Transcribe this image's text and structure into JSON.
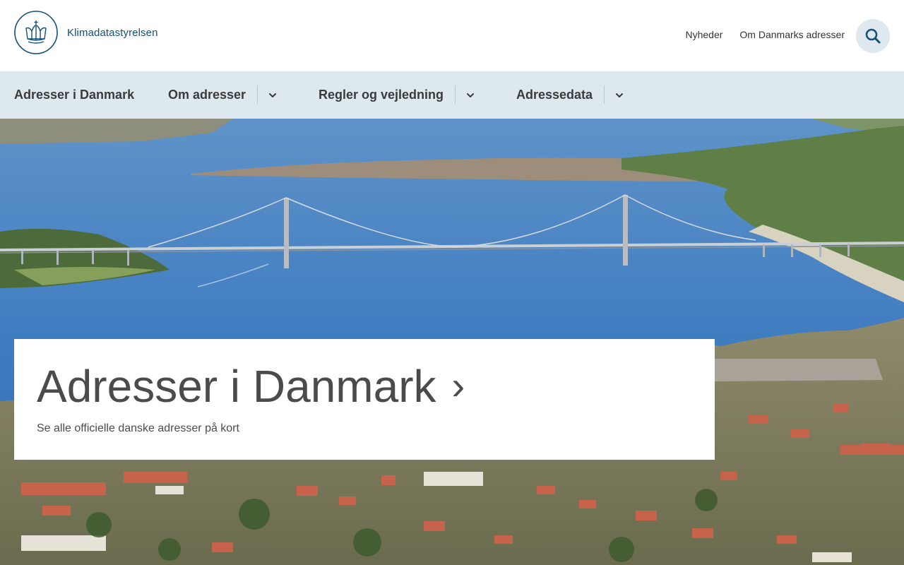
{
  "header": {
    "logo_text": "Klimadatastyrelsen",
    "links": [
      "Nyheder",
      "Om Danmarks adresser"
    ],
    "search_icon": "search-icon"
  },
  "nav": {
    "items": [
      {
        "label": "Adresser i Danmark",
        "has_dropdown": false
      },
      {
        "label": "Om adresser",
        "has_dropdown": true
      },
      {
        "label": "Regler og vejledning",
        "has_dropdown": true
      },
      {
        "label": "Adressedata",
        "has_dropdown": true
      }
    ]
  },
  "hero": {
    "image": "aerial-bridge-photo",
    "card_title": "Adresser i Danmark",
    "card_arrow": "›",
    "card_subtitle": "Se alle officielle danske adresser på kort"
  },
  "colors": {
    "brand": "#14507a",
    "nav_bg": "#dde8ef",
    "search_bg": "#dfe8ee"
  }
}
